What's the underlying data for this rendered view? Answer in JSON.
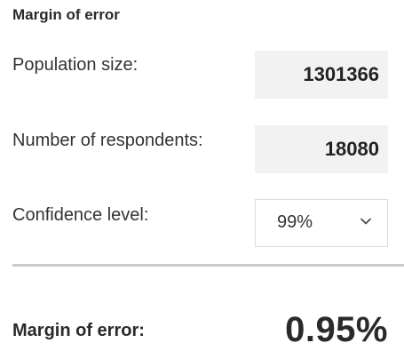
{
  "calculator": {
    "title": "Margin of error",
    "population": {
      "label": "Population size:",
      "value": "1301366"
    },
    "respondents": {
      "label": "Number of respondents:",
      "value": "18080"
    },
    "confidence": {
      "label": "Confidence level:",
      "selected": "99%",
      "icon": "chevron-down-icon"
    },
    "result": {
      "label": "Margin of error:",
      "value": "0.95%"
    }
  },
  "colors": {
    "input_background": "#f2f2f2",
    "divider": "#c9c9c9",
    "text": "#2a2a2a"
  }
}
